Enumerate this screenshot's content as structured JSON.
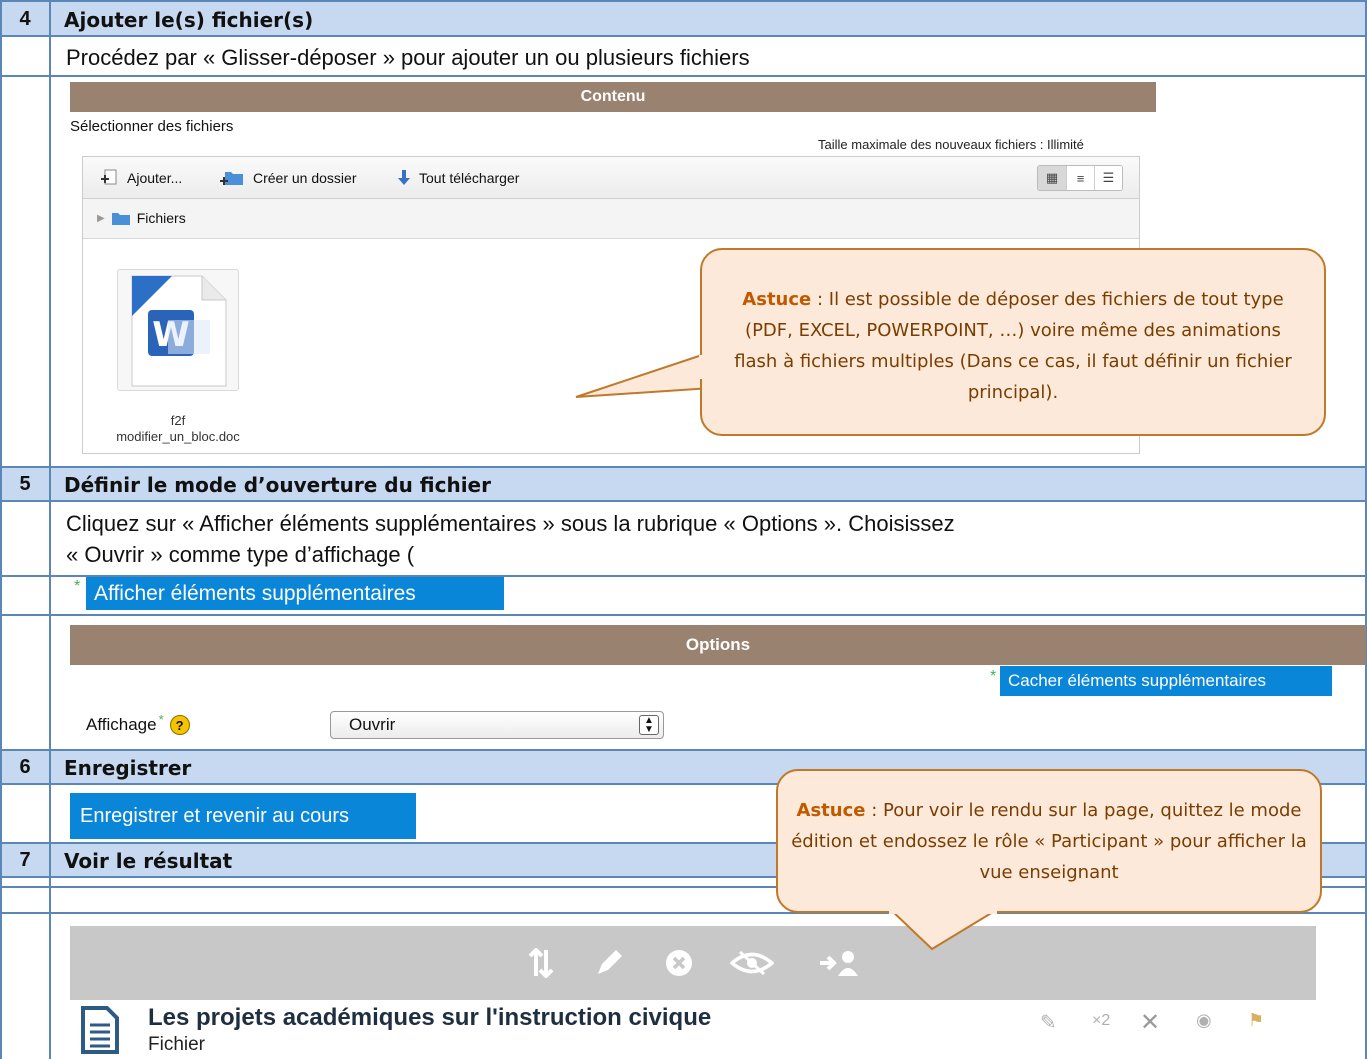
{
  "rows": [
    {
      "num": "4",
      "title": "Ajouter  le(s) fichier(s)"
    },
    {
      "num": "5",
      "title": "Définir le mode d’ouverture du fichier"
    },
    {
      "num": "6",
      "title": "Enregistrer"
    },
    {
      "num": "7",
      "title": "Voir le résultat"
    }
  ],
  "step4": {
    "instruction": "Procédez par « Glisser-déposer » pour ajouter un ou plusieurs fichiers",
    "panel_title": "Contenu",
    "select_files": "Sélectionner des fichiers",
    "max_size": "Taille maximale des nouveaux fichiers : Illimité",
    "toolbar": {
      "add": "Ajouter...",
      "create_folder": "Créer un dossier",
      "download_all": "Tout télécharger"
    },
    "path_folder": "Fichiers",
    "file_line1": "f2f",
    "file_line2": "modifier_un_bloc.doc",
    "tip_strong": "Astuce",
    "tip_text": " : Il est possible de déposer des fichiers de tout type (PDF, EXCEL, POWERPOINT, …) voire même des animations flash à fichiers multiples (Dans ce cas, il faut définir un fichier principal)."
  },
  "step5": {
    "instruction_l1": "Cliquez sur « Afficher éléments supplémentaires » sous la rubrique « Options ». Choisissez",
    "instruction_l2": "« Ouvrir » comme type d’affichage (",
    "show_more": "Afficher éléments supplémentaires",
    "options_title": "Options",
    "hide_more": "Cacher éléments supplémentaires",
    "display_label": "Affichage",
    "display_value": "Ouvrir"
  },
  "step6": {
    "save_button": "Enregistrer et revenir au cours",
    "tip_strong": "Astuce",
    "tip_text": " : Pour voir le rendu sur la page, quittez le mode édition et endossez le rôle « Participant » pour afficher la vue enseignant"
  },
  "step7": {
    "resource_title": "Les projets académiques sur l'instruction civique",
    "resource_type": "Fichier",
    "small_x2": "×2"
  },
  "colors": {
    "header_bg": "#c6d9f1",
    "border": "#5b86b8",
    "panel_bar": "#998270",
    "button_blue": "#0a86d9",
    "callout_bg": "#fde9d9",
    "callout_border": "#c0782b"
  }
}
